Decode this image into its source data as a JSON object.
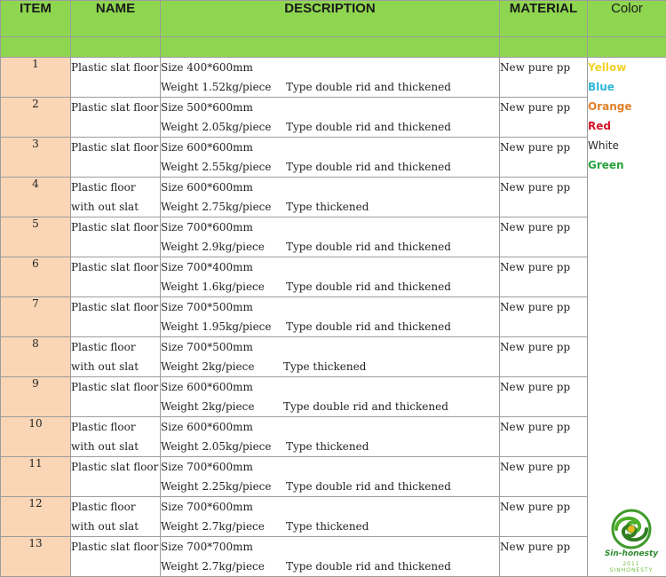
{
  "headers": {
    "item": "ITEM",
    "name": "NAME",
    "description": "DESCRIPTION",
    "material": "MATERIAL",
    "color": "Color"
  },
  "colors": [
    {
      "label": "Yellow",
      "hex": "#f2d22a"
    },
    {
      "label": "Blue",
      "hex": "#2fb7d8"
    },
    {
      "label": "Orange",
      "hex": "#e0802b"
    },
    {
      "label": "Red",
      "hex": "#d3162a"
    },
    {
      "label": "White",
      "hex": "#2a2a2a"
    },
    {
      "label": "Green",
      "hex": "#27a23c"
    }
  ],
  "items": [
    {
      "item": "1",
      "name": [
        "Plastic slat floor"
      ],
      "size": "Size 400*600mm",
      "weight": "Weight 1.52kg/piece",
      "type": "Type double rid and thickened",
      "material": "New pure pp"
    },
    {
      "item": "2",
      "name": [
        "Plastic slat floor"
      ],
      "size": "Size 500*600mm",
      "weight": "Weight 2.05kg/piece",
      "type": "Type double rid and thickened",
      "material": "New pure pp"
    },
    {
      "item": "3",
      "name": [
        "Plastic slat floor"
      ],
      "size": "Size 600*600mm",
      "weight": "Weight 2.55kg/piece",
      "type": "Type double rid and thickened",
      "material": "New pure pp"
    },
    {
      "item": "4",
      "name": [
        "Plastic floor",
        "with out slat"
      ],
      "size": "Size 600*600mm",
      "weight": "Weight 2.75kg/piece",
      "type": "Type thickened",
      "material": "New pure pp"
    },
    {
      "item": "5",
      "name": [
        "Plastic slat floor"
      ],
      "size": "Size 700*600mm",
      "weight": "Weight 2.9kg/piece",
      "type": "Type double rid and thickened",
      "material": "New pure pp"
    },
    {
      "item": "6",
      "name": [
        "Plastic slat floor"
      ],
      "size": "Size 700*400mm",
      "weight": "Weight 1.6kg/piece",
      "type": "Type double rid and thickened",
      "material": "New pure pp"
    },
    {
      "item": "7",
      "name": [
        "Plastic slat floor"
      ],
      "size": "Size 700*500mm",
      "weight": "Weight 1.95kg/piece",
      "type": "Type double rid and thickened",
      "material": "New pure pp"
    },
    {
      "item": "8",
      "name": [
        "Plastic floor",
        "with out slat"
      ],
      "size": "Size 700*500mm",
      "weight": "Weight 2kg/piece",
      "type": "Type thickened",
      "material": "New pure pp"
    },
    {
      "item": "9",
      "name": [
        "Plastic slat floor"
      ],
      "size": "Size 600*600mm",
      "weight": "Weight 2kg/piece",
      "type": "Type double rid and thickened",
      "material": "New pure pp"
    },
    {
      "item": "10",
      "name": [
        "Plastic floor",
        "with out slat"
      ],
      "size": "Size 600*600mm",
      "weight": "Weight 2.05kg/piece",
      "type": "Type thickened",
      "material": "New pure pp"
    },
    {
      "item": "11",
      "name": [
        "Plastic slat floor"
      ],
      "size": "Size 700*600mm",
      "weight": "Weight 2.25kg/piece",
      "type": "Type double rid and thickened",
      "material": "New pure pp"
    },
    {
      "item": "12",
      "name": [
        "Plastic floor",
        "with out slat"
      ],
      "size": "Size 700*600mm",
      "weight": "Weight 2.7kg/piece",
      "type": "Type thickened",
      "material": "New pure pp"
    },
    {
      "item": "13",
      "name": [
        "Plastic slat floor"
      ],
      "size": "Size 700*700mm",
      "weight": "Weight 2.7kg/piece",
      "type": "Type double rid and thickened",
      "material": "New pure pp"
    }
  ],
  "logo": {
    "name": "Sin-honesty",
    "tagline": "2011 SINHONESTY"
  }
}
